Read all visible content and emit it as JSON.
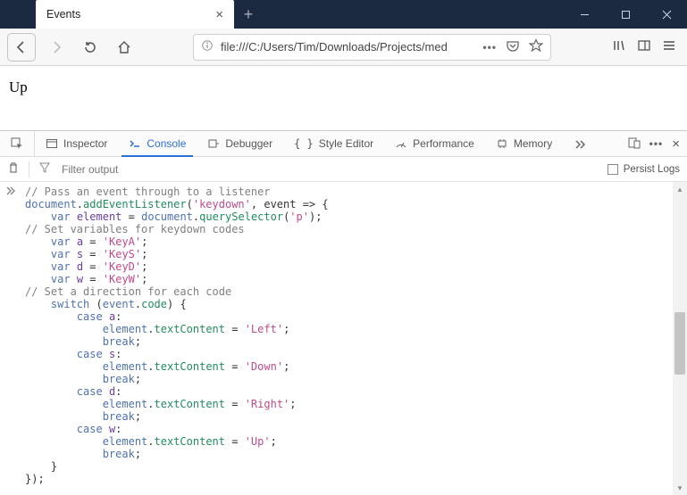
{
  "window": {
    "tab_title": "Events",
    "min": "–",
    "close": "×"
  },
  "nav": {
    "url": "file:///C:/Users/Tim/Downloads/Projects/med",
    "dots": "•••"
  },
  "page": {
    "text": "Up"
  },
  "devtools": {
    "tabs": {
      "inspector": "Inspector",
      "console": "Console",
      "debugger": "Debugger",
      "style": "Style Editor",
      "perf": "Performance",
      "memory": "Memory"
    },
    "dots": "•••",
    "filter_placeholder": "Filter output",
    "persist": "Persist Logs"
  },
  "code": {
    "l1_comment": "// Pass an event through to a listener",
    "l2_a": "document",
    "l2_b": "addEventListener",
    "l2_c": "'keydown'",
    "l3_kw": "var",
    "l3_id": "element",
    "l3_obj": "document",
    "l3_m": "querySelector",
    "l3_s": "'p'",
    "l4_comment": "// Set variables for keydown codes",
    "l5_kw": "var",
    "l5_id": "a",
    "l5_s": "'KeyA'",
    "l6_kw": "var",
    "l6_id": "s",
    "l6_s": "'KeyS'",
    "l7_kw": "var",
    "l7_id": "d",
    "l7_s": "'KeyD'",
    "l8_kw": "var",
    "l8_id": "w",
    "l8_s": "'KeyW'",
    "l9_comment": "// Set a direction for each code",
    "l10_sw": "switch",
    "l10_ev": "event",
    "l10_code": "code",
    "l11_case": "case",
    "l11_v": "a",
    "l12_el": "element",
    "l12_p": "textContent",
    "l12_s": "'Left'",
    "l13_br": "break",
    "l14_case": "case",
    "l14_v": "s",
    "l15_el": "element",
    "l15_p": "textContent",
    "l15_s": "'Down'",
    "l16_br": "break",
    "l17_case": "case",
    "l17_v": "d",
    "l18_el": "element",
    "l18_p": "textContent",
    "l18_s": "'Right'",
    "l19_br": "break",
    "l20_case": "case",
    "l20_v": "w",
    "l21_el": "element",
    "l21_p": "textContent",
    "l21_s": "'Up'",
    "l22_br": "break",
    "l23": "    }",
    "l24": "});"
  }
}
